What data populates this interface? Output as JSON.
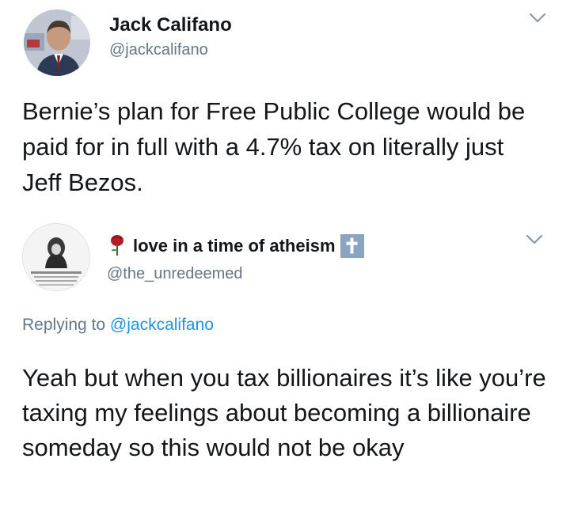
{
  "tweet1": {
    "name": "Jack Califano",
    "handle": "@jackcalifano",
    "text": "Bernie’s plan for Free Public College would be paid for in full with a 4.7% tax on literally just Jeff Bezos.",
    "menu_icon": "chevron-down-icon"
  },
  "tweet2": {
    "name": "love in a time of atheism",
    "name_prefix_icon": "rose-icon",
    "name_suffix_icon": "cross-icon",
    "cross_glyph": "✝",
    "handle": "@the_unredeemed",
    "replying_prefix": "Replying to ",
    "replying_to": "@jackcalifano",
    "text": "Yeah but when you tax billionaires it’s like you’re taxing my feelings about becoming a billionaire someday so this would not be okay",
    "menu_icon": "chevron-down-icon"
  },
  "colors": {
    "text": "#14171a",
    "secondary": "#657786",
    "link": "#1b95e0",
    "cross_badge": "#8aa5c2"
  }
}
